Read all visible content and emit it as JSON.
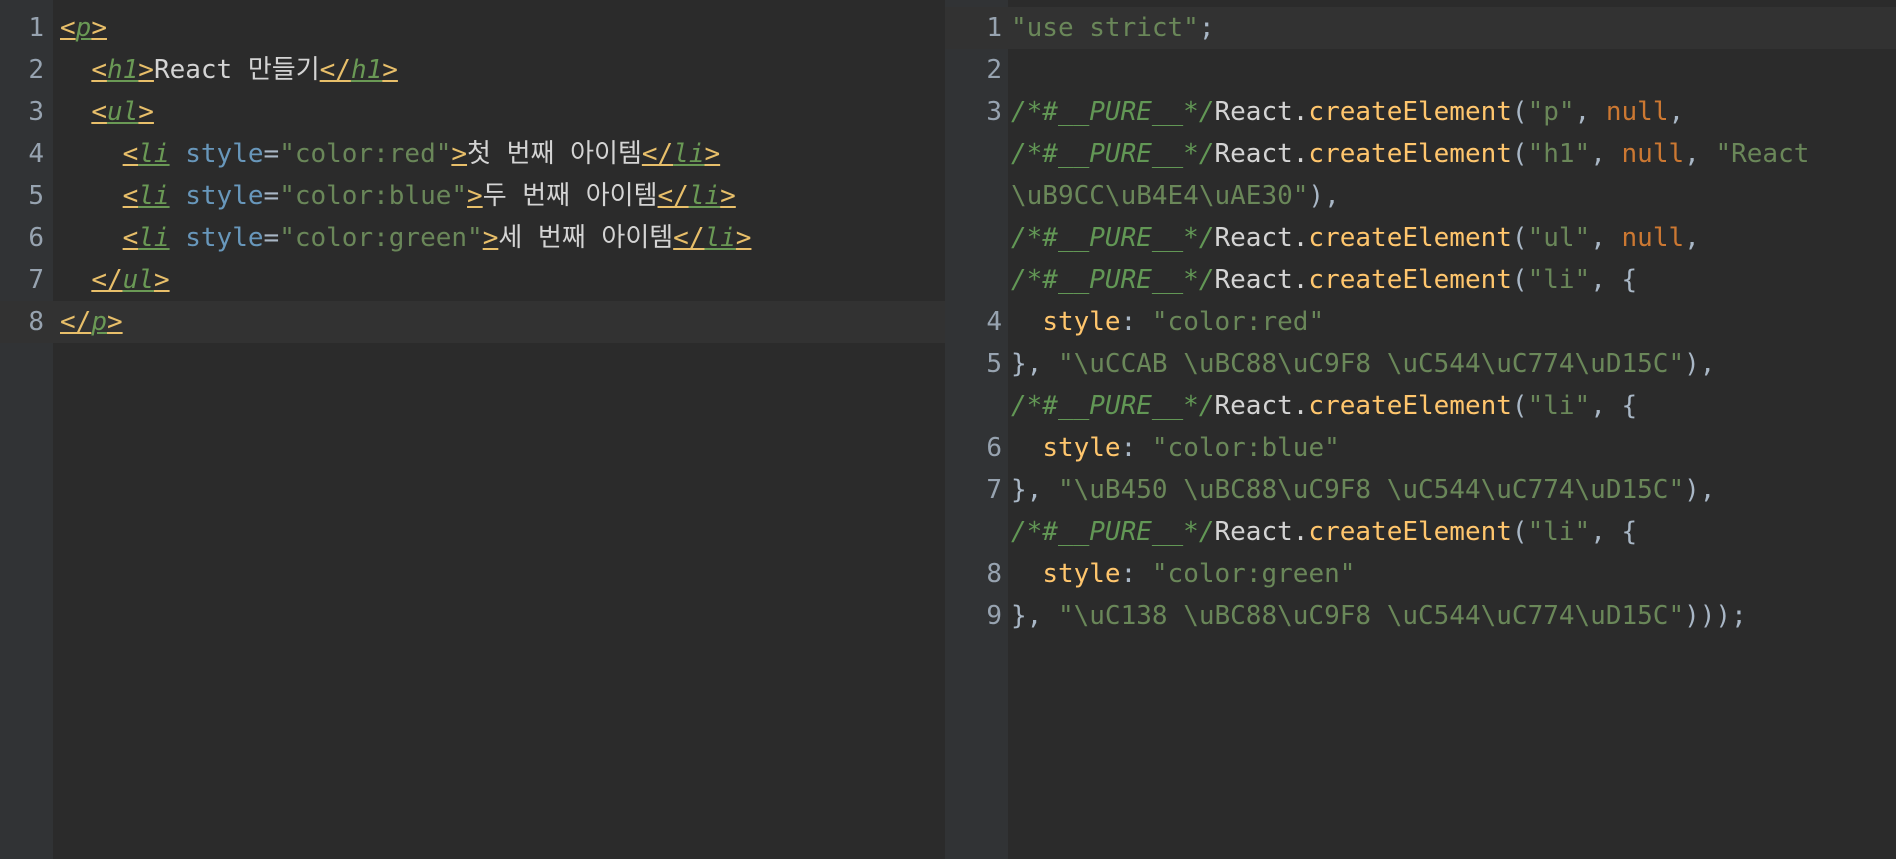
{
  "left_editor": {
    "lines": [
      {
        "num": "1",
        "segments": [
          [
            "tag",
            "<"
          ],
          [
            "tagname",
            "p"
          ],
          [
            "tag",
            ">"
          ]
        ]
      },
      {
        "num": "2",
        "segments": [
          [
            "txt",
            "  "
          ],
          [
            "tag",
            "<"
          ],
          [
            "tagname",
            "h1"
          ],
          [
            "tag",
            ">"
          ],
          [
            "txt",
            "React 만들기"
          ],
          [
            "tag",
            "</"
          ],
          [
            "tagname",
            "h1"
          ],
          [
            "tag",
            ">"
          ]
        ]
      },
      {
        "num": "3",
        "segments": [
          [
            "txt",
            "  "
          ],
          [
            "tag",
            "<"
          ],
          [
            "tagname",
            "ul"
          ],
          [
            "tag",
            ">"
          ]
        ]
      },
      {
        "num": "4",
        "segments": [
          [
            "txt",
            "    "
          ],
          [
            "tag",
            "<"
          ],
          [
            "tagname",
            "li"
          ],
          [
            "txt",
            " "
          ],
          [
            "attr",
            "style"
          ],
          [
            "punct",
            "="
          ],
          [
            "attrval",
            "\"color:red\""
          ],
          [
            "tag",
            ">"
          ],
          [
            "txt",
            "첫 번째 아이템"
          ],
          [
            "tag",
            "</"
          ],
          [
            "tagname",
            "li"
          ],
          [
            "tag",
            ">"
          ]
        ]
      },
      {
        "num": "5",
        "segments": [
          [
            "txt",
            "    "
          ],
          [
            "tag",
            "<"
          ],
          [
            "tagname",
            "li"
          ],
          [
            "txt",
            " "
          ],
          [
            "attr",
            "style"
          ],
          [
            "punct",
            "="
          ],
          [
            "attrval",
            "\"color:blue\""
          ],
          [
            "tag",
            ">"
          ],
          [
            "txt",
            "두 번째 아이템"
          ],
          [
            "tag",
            "</"
          ],
          [
            "tagname",
            "li"
          ],
          [
            "tag",
            ">"
          ]
        ]
      },
      {
        "num": "6",
        "segments": [
          [
            "txt",
            "    "
          ],
          [
            "tag",
            "<"
          ],
          [
            "tagname",
            "li"
          ],
          [
            "txt",
            " "
          ],
          [
            "attr",
            "style"
          ],
          [
            "punct",
            "="
          ],
          [
            "attrval",
            "\"color:green\""
          ],
          [
            "tag",
            ">"
          ],
          [
            "txt",
            "세 번째 아이템"
          ],
          [
            "tag",
            "</"
          ],
          [
            "tagname",
            "li"
          ],
          [
            "tag",
            ">"
          ]
        ]
      },
      {
        "num": "7",
        "segments": [
          [
            "txt",
            "  "
          ],
          [
            "tag",
            "</"
          ],
          [
            "tagname",
            "ul"
          ],
          [
            "tag",
            ">"
          ]
        ]
      },
      {
        "num": "8",
        "segments": [
          [
            "tag",
            "</"
          ],
          [
            "tagname",
            "p"
          ],
          [
            "tag",
            ">"
          ]
        ]
      }
    ]
  },
  "right_editor": {
    "lines": [
      {
        "num": "1",
        "segments": [
          [
            "str",
            "\"use strict\""
          ],
          [
            "punct",
            ";"
          ]
        ]
      },
      {
        "num": "2",
        "segments": []
      },
      {
        "num": "3",
        "segments": [
          [
            "comment",
            "/*#__PURE__*/"
          ],
          [
            "ident",
            "React."
          ],
          [
            "fn",
            "createElement"
          ],
          [
            "punct",
            "("
          ],
          [
            "str",
            "\"p\""
          ],
          [
            "punct",
            ", "
          ],
          [
            "kw",
            "null"
          ],
          [
            "punct",
            ","
          ]
        ]
      },
      {
        "num": "",
        "segments": [
          [
            "comment",
            "/*#__PURE__*/"
          ],
          [
            "ident",
            "React."
          ],
          [
            "fn",
            "createElement"
          ],
          [
            "punct",
            "("
          ],
          [
            "str",
            "\"h1\""
          ],
          [
            "punct",
            ", "
          ],
          [
            "kw",
            "null"
          ],
          [
            "punct",
            ", "
          ],
          [
            "str",
            "\"React"
          ]
        ]
      },
      {
        "num": "",
        "segments": [
          [
            "str",
            "\\uB9CC\\uB4E4\\uAE30\""
          ],
          [
            "punct",
            "),"
          ]
        ]
      },
      {
        "num": "",
        "segments": [
          [
            "comment",
            "/*#__PURE__*/"
          ],
          [
            "ident",
            "React."
          ],
          [
            "fn",
            "createElement"
          ],
          [
            "punct",
            "("
          ],
          [
            "str",
            "\"ul\""
          ],
          [
            "punct",
            ", "
          ],
          [
            "kw",
            "null"
          ],
          [
            "punct",
            ","
          ]
        ]
      },
      {
        "num": "",
        "segments": [
          [
            "comment",
            "/*#__PURE__*/"
          ],
          [
            "ident",
            "React."
          ],
          [
            "fn",
            "createElement"
          ],
          [
            "punct",
            "("
          ],
          [
            "str",
            "\"li\""
          ],
          [
            "punct",
            ", {"
          ]
        ]
      },
      {
        "num": "4",
        "segments": [
          [
            "txt",
            "  "
          ],
          [
            "prop",
            "style"
          ],
          [
            "punct",
            ": "
          ],
          [
            "str",
            "\"color:red\""
          ]
        ]
      },
      {
        "num": "5",
        "segments": [
          [
            "punct",
            "}, "
          ],
          [
            "str",
            "\"\\uCCAB \\uBC88\\uC9F8 \\uC544\\uC774\\uD15C\""
          ],
          [
            "punct",
            "),"
          ]
        ]
      },
      {
        "num": "",
        "segments": [
          [
            "comment",
            "/*#__PURE__*/"
          ],
          [
            "ident",
            "React."
          ],
          [
            "fn",
            "createElement"
          ],
          [
            "punct",
            "("
          ],
          [
            "str",
            "\"li\""
          ],
          [
            "punct",
            ", {"
          ]
        ]
      },
      {
        "num": "6",
        "segments": [
          [
            "txt",
            "  "
          ],
          [
            "prop",
            "style"
          ],
          [
            "punct",
            ": "
          ],
          [
            "str",
            "\"color:blue\""
          ]
        ]
      },
      {
        "num": "7",
        "segments": [
          [
            "punct",
            "}, "
          ],
          [
            "str",
            "\"\\uB450 \\uBC88\\uC9F8 \\uC544\\uC774\\uD15C\""
          ],
          [
            "punct",
            "),"
          ]
        ]
      },
      {
        "num": "",
        "segments": [
          [
            "comment",
            "/*#__PURE__*/"
          ],
          [
            "ident",
            "React."
          ],
          [
            "fn",
            "createElement"
          ],
          [
            "punct",
            "("
          ],
          [
            "str",
            "\"li\""
          ],
          [
            "punct",
            ", {"
          ]
        ]
      },
      {
        "num": "8",
        "segments": [
          [
            "txt",
            "  "
          ],
          [
            "prop",
            "style"
          ],
          [
            "punct",
            ": "
          ],
          [
            "str",
            "\"color:green\""
          ]
        ]
      },
      {
        "num": "9",
        "segments": [
          [
            "punct",
            "}, "
          ],
          [
            "str",
            "\"\\uC138 \\uBC88\\uC9F8 \\uC544\\uC774\\uD15C\""
          ],
          [
            "punct",
            ")));"
          ]
        ]
      }
    ]
  },
  "colors": {
    "background": "#2b2b2b",
    "gutter": "#313335",
    "current_line": "#323232",
    "tag_bracket": "#e8bf6a",
    "tag_name": "#6a9955",
    "attribute": "#6897bb",
    "string": "#6a8759",
    "comment": "#629755",
    "function": "#ffc66d",
    "keyword": "#cc7832"
  }
}
